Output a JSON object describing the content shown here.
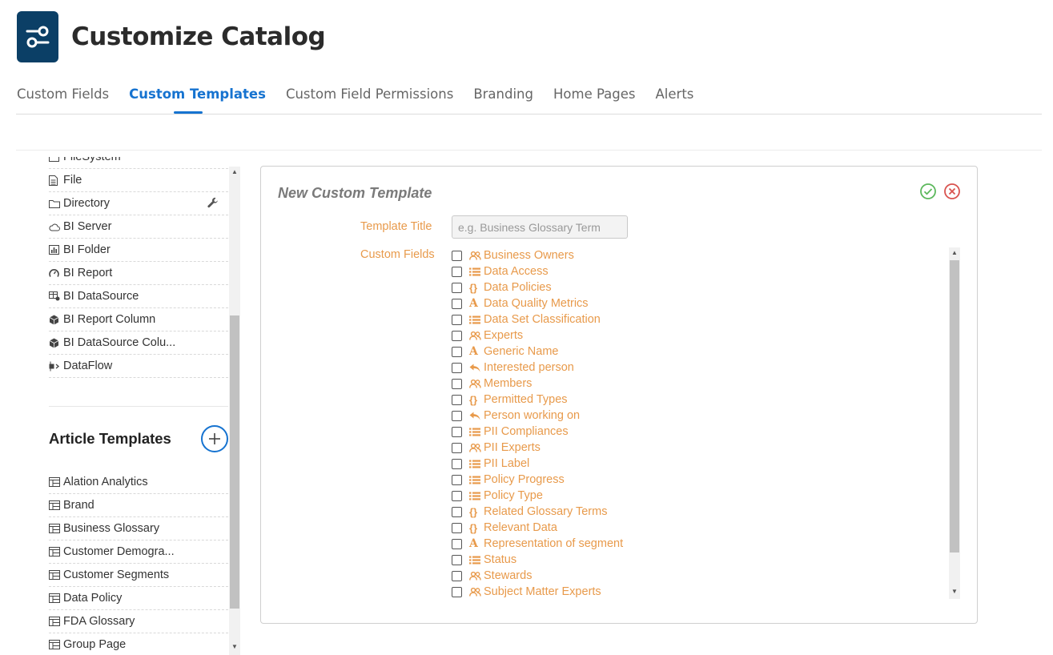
{
  "header": {
    "title": "Customize Catalog",
    "logo_icon": "sliders-icon",
    "logo_color": "#0b3f66"
  },
  "tabs": [
    {
      "label": "Custom Fields"
    },
    {
      "label": "Custom Templates",
      "active": true
    },
    {
      "label": "Custom Field Permissions"
    },
    {
      "label": "Branding"
    },
    {
      "label": "Home Pages"
    },
    {
      "label": "Alerts"
    }
  ],
  "sidebar": {
    "object_items": [
      {
        "label": "FileSystem",
        "icon": "filesystem-icon"
      },
      {
        "label": "File",
        "icon": "file-icon"
      },
      {
        "label": "Directory",
        "icon": "folder-icon",
        "action_icon": "wrench-icon"
      },
      {
        "label": "BI Server",
        "icon": "cloud-icon"
      },
      {
        "label": "BI Folder",
        "icon": "bar-chart-icon"
      },
      {
        "label": "BI Report",
        "icon": "gauge-icon"
      },
      {
        "label": "BI DataSource",
        "icon": "datasource-icon"
      },
      {
        "label": "BI Report Column",
        "icon": "cube-icon"
      },
      {
        "label": "BI DataSource Colu...",
        "icon": "cube-icon"
      },
      {
        "label": "DataFlow",
        "icon": "dataflow-icon"
      }
    ],
    "article_section_title": "Article Templates",
    "add_icon": "plus-icon",
    "article_items": [
      {
        "label": "Alation Analytics",
        "icon": "template-icon"
      },
      {
        "label": "Brand",
        "icon": "template-icon"
      },
      {
        "label": "Business Glossary",
        "icon": "template-icon"
      },
      {
        "label": "Customer Demogra...",
        "icon": "template-icon"
      },
      {
        "label": "Customer Segments",
        "icon": "template-icon"
      },
      {
        "label": "Data Policy",
        "icon": "template-icon"
      },
      {
        "label": "FDA Glossary",
        "icon": "template-icon"
      },
      {
        "label": "Group Page",
        "icon": "template-icon"
      }
    ]
  },
  "panel": {
    "title": "New Custom Template",
    "confirm_icon": "check-circle-icon",
    "cancel_icon": "x-circle-icon",
    "template_title_label": "Template Title",
    "template_title_placeholder": "e.g. Business Glossary Term",
    "template_title_value": "",
    "custom_fields_label": "Custom Fields",
    "field_color": "#e89a4b",
    "fields": [
      {
        "label": "Business Owners",
        "icon": "people-icon",
        "checked": false
      },
      {
        "label": "Data Access",
        "icon": "list-icon",
        "checked": false
      },
      {
        "label": "Data Policies",
        "icon": "braces-icon",
        "checked": false
      },
      {
        "label": "Data Quality Metrics",
        "icon": "text-icon",
        "checked": false
      },
      {
        "label": "Data Set Classification",
        "icon": "list-icon",
        "checked": false
      },
      {
        "label": "Experts",
        "icon": "people-icon",
        "checked": false
      },
      {
        "label": "Generic Name",
        "icon": "text-icon",
        "checked": false
      },
      {
        "label": "Interested person",
        "icon": "reply-icon",
        "checked": false
      },
      {
        "label": "Members",
        "icon": "people-icon",
        "checked": false
      },
      {
        "label": "Permitted Types",
        "icon": "braces-icon",
        "checked": false
      },
      {
        "label": "Person working on",
        "icon": "reply-icon",
        "checked": false
      },
      {
        "label": "PII Compliances",
        "icon": "list-icon",
        "checked": false
      },
      {
        "label": "PII Experts",
        "icon": "people-icon",
        "checked": false
      },
      {
        "label": "PII Label",
        "icon": "list-icon",
        "checked": false
      },
      {
        "label": "Policy Progress",
        "icon": "list-icon",
        "checked": false
      },
      {
        "label": "Policy Type",
        "icon": "list-icon",
        "checked": false
      },
      {
        "label": "Related Glossary Terms",
        "icon": "braces-icon",
        "checked": false
      },
      {
        "label": "Relevant Data",
        "icon": "braces-icon",
        "checked": false
      },
      {
        "label": "Representation of segment",
        "icon": "text-icon",
        "checked": false
      },
      {
        "label": "Status",
        "icon": "list-icon",
        "checked": false
      },
      {
        "label": "Stewards",
        "icon": "people-icon",
        "checked": false
      },
      {
        "label": "Subject Matter Experts",
        "icon": "people-icon",
        "checked": false
      }
    ]
  }
}
